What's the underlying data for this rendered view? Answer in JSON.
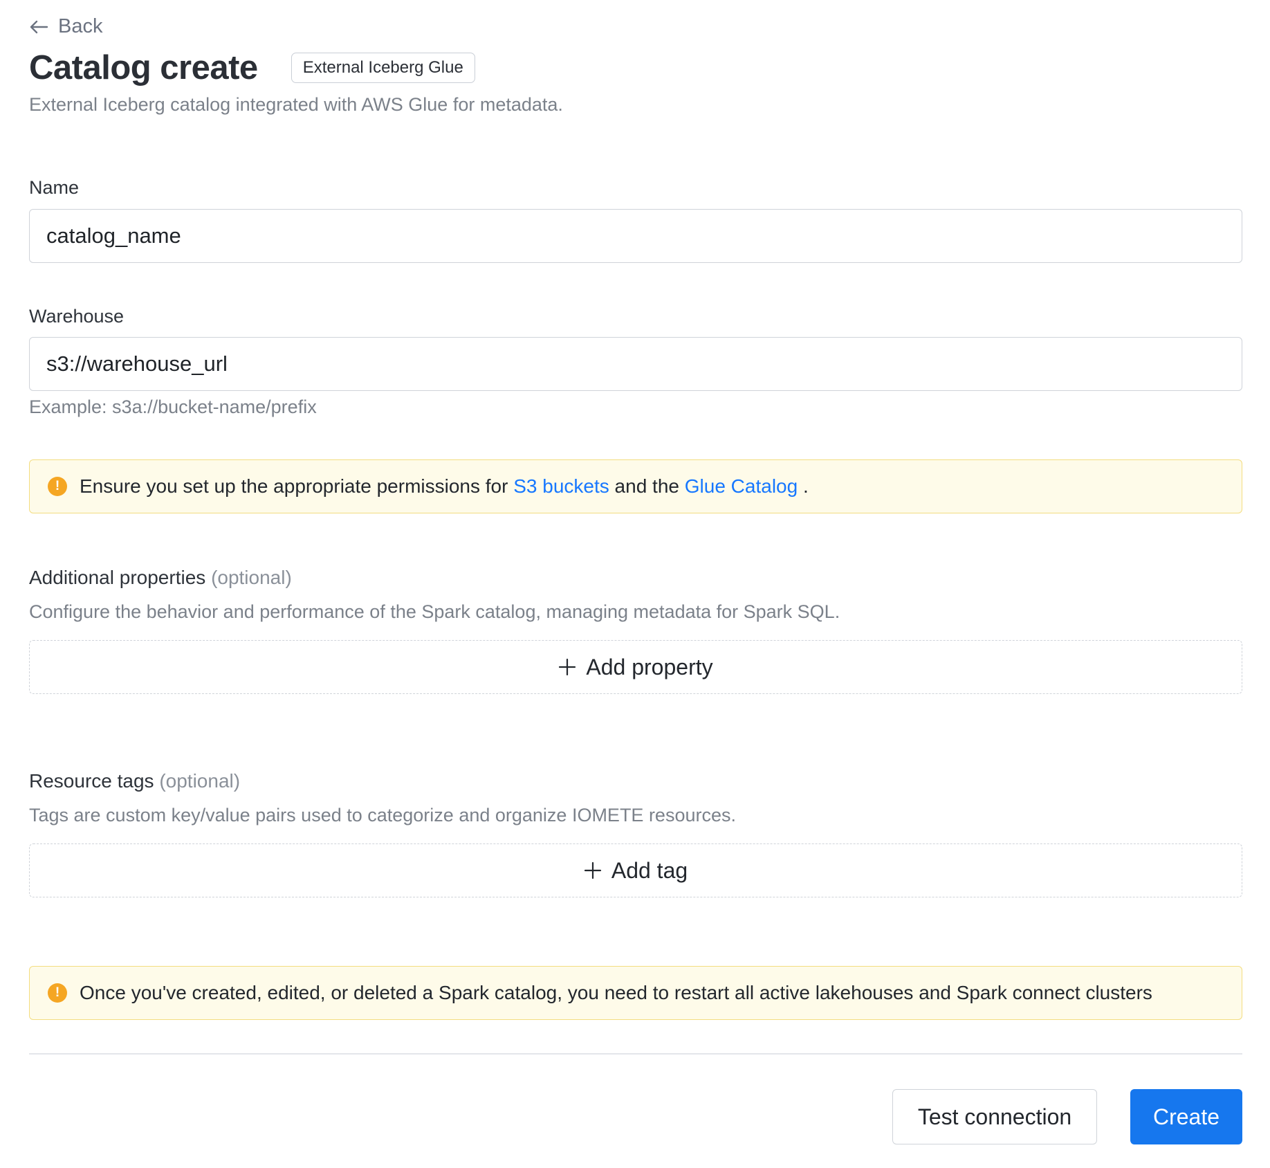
{
  "header": {
    "back_label": "Back",
    "title": "Catalog create",
    "badge": "External Iceberg Glue",
    "subtitle": "External Iceberg catalog integrated with AWS Glue for metadata."
  },
  "form": {
    "name": {
      "label": "Name",
      "value": "catalog_name"
    },
    "warehouse": {
      "label": "Warehouse",
      "value": "s3://warehouse_url",
      "hint": "Example: s3a://bucket-name/prefix"
    }
  },
  "permissions_alert": {
    "text_before": "Ensure you set up the appropriate permissions for",
    "link1": "S3 buckets",
    "text_middle": "and the",
    "link2": "Glue Catalog",
    "text_after": "."
  },
  "additional_properties": {
    "title": "Additional properties",
    "optional": "(optional)",
    "description": "Configure the behavior and performance of the Spark catalog, managing metadata for Spark SQL.",
    "add_label": "Add property"
  },
  "resource_tags": {
    "title": "Resource tags",
    "optional": "(optional)",
    "description": "Tags are custom key/value pairs used to categorize and organize IOMETE resources.",
    "add_label": "Add tag"
  },
  "restart_alert": {
    "text": "Once you've created, edited, or deleted a Spark catalog, you need to restart all active lakehouses and Spark connect clusters"
  },
  "footer": {
    "test_label": "Test connection",
    "create_label": "Create"
  },
  "icons": {
    "back": "arrow-left-icon",
    "alert": "exclamation-circle-icon",
    "add": "plus-icon"
  },
  "colors": {
    "primary": "#1677ee",
    "link": "#1677ff",
    "alert_bg": "#fefbe9",
    "alert_border": "#f3dd80",
    "alert_icon": "#f5a623"
  }
}
